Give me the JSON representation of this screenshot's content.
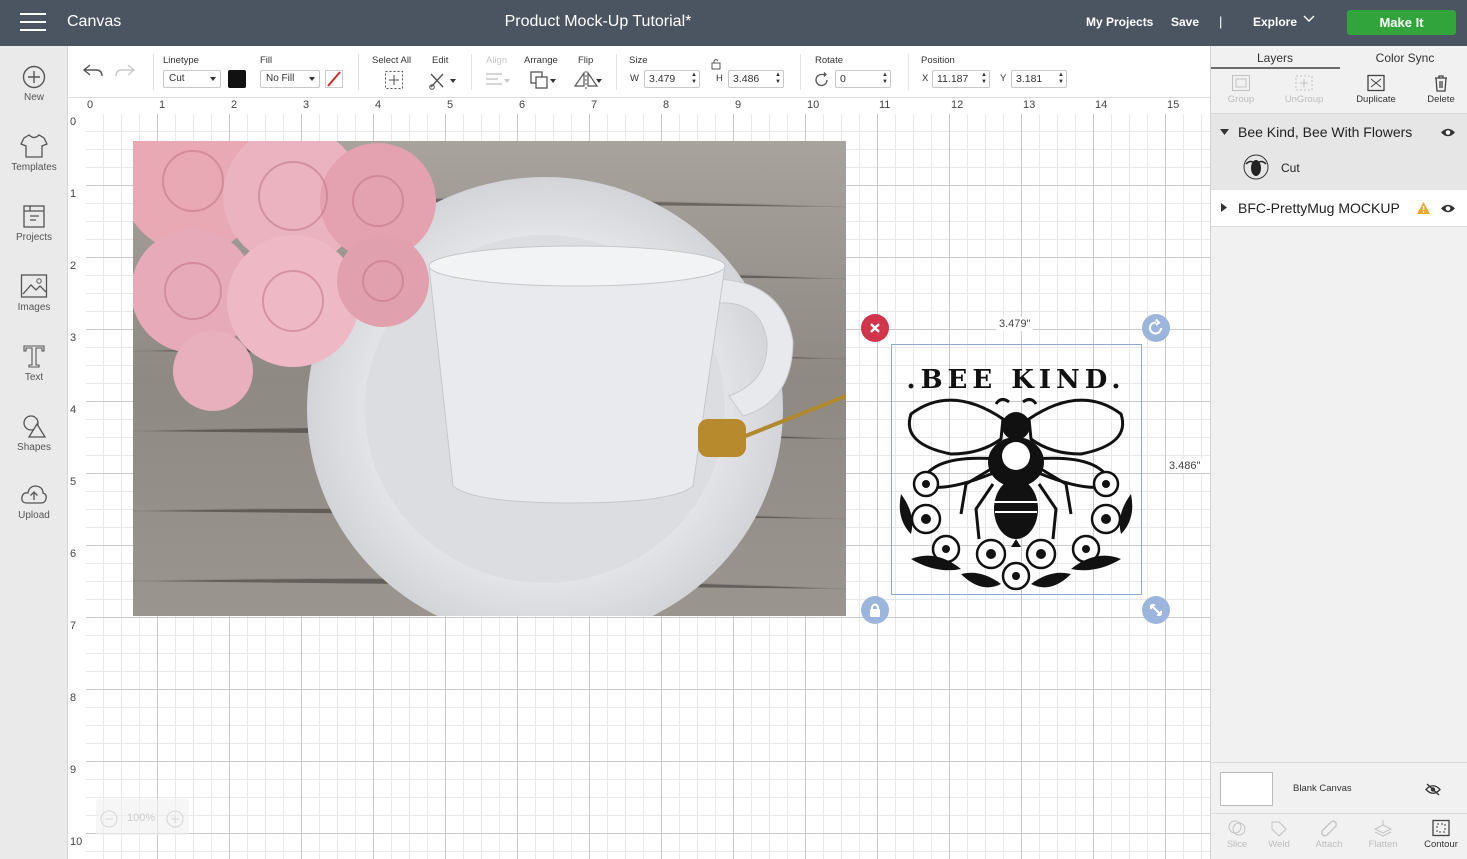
{
  "topbar": {
    "app_title": "Canvas",
    "doc_title": "Product Mock-Up Tutorial*",
    "my_projects": "My Projects",
    "save": "Save",
    "separator": "|",
    "explore": "Explore",
    "make_it": "Make It",
    "make_it_color": "#31a53c",
    "bar_color": "#4b5561"
  },
  "sidebar": {
    "items": [
      {
        "label": "New",
        "icon": "plus-circle-icon"
      },
      {
        "label": "Templates",
        "icon": "tshirt-icon"
      },
      {
        "label": "Projects",
        "icon": "projects-icon"
      },
      {
        "label": "Images",
        "icon": "image-icon"
      },
      {
        "label": "Text",
        "icon": "text-icon"
      },
      {
        "label": "Shapes",
        "icon": "shapes-icon"
      },
      {
        "label": "Upload",
        "icon": "upload-cloud-icon"
      }
    ]
  },
  "toolbar": {
    "linetype_label": "Linetype",
    "linetype_value": "Cut",
    "fill_label": "Fill",
    "fill_value": "No Fill",
    "fill_color": "#111111",
    "select_all_label": "Select All",
    "edit_label": "Edit",
    "align_label": "Align",
    "arrange_label": "Arrange",
    "flip_label": "Flip",
    "size_label": "Size",
    "w_label": "W",
    "w_value": "3.479",
    "h_label": "H",
    "h_value": "3.486",
    "rotate_label": "Rotate",
    "rotate_value": "0",
    "position_label": "Position",
    "x_label": "X",
    "x_value": "11.187",
    "y_label": "Y",
    "y_value": "3.181"
  },
  "ruler": {
    "top": [
      "0",
      "1",
      "2",
      "3",
      "4",
      "5",
      "6",
      "7",
      "8",
      "9",
      "10",
      "11",
      "12",
      "13",
      "14",
      "15"
    ],
    "left": [
      "0",
      "1",
      "2",
      "3",
      "4",
      "5",
      "6",
      "7",
      "8",
      "9",
      "10"
    ]
  },
  "canvas": {
    "selection": {
      "width_label": "3.479\"",
      "height_label": "3.486\""
    },
    "zoom": "100%",
    "bee_text": ".BEE KIND."
  },
  "panel": {
    "tabs": [
      "Layers",
      "Color Sync"
    ],
    "actions": [
      {
        "label": "Group"
      },
      {
        "label": "UnGroup"
      },
      {
        "label": "Duplicate"
      },
      {
        "label": "Delete"
      }
    ],
    "layers": [
      {
        "name": "Bee Kind, Bee With Flowers",
        "child": "Cut"
      },
      {
        "name": "BFC-PrettyMug MOCKUP"
      }
    ],
    "blank_canvas": "Blank Canvas",
    "bottom_actions": [
      {
        "label": "Slice"
      },
      {
        "label": "Weld"
      },
      {
        "label": "Attach"
      },
      {
        "label": "Flatten"
      },
      {
        "label": "Contour"
      }
    ]
  }
}
